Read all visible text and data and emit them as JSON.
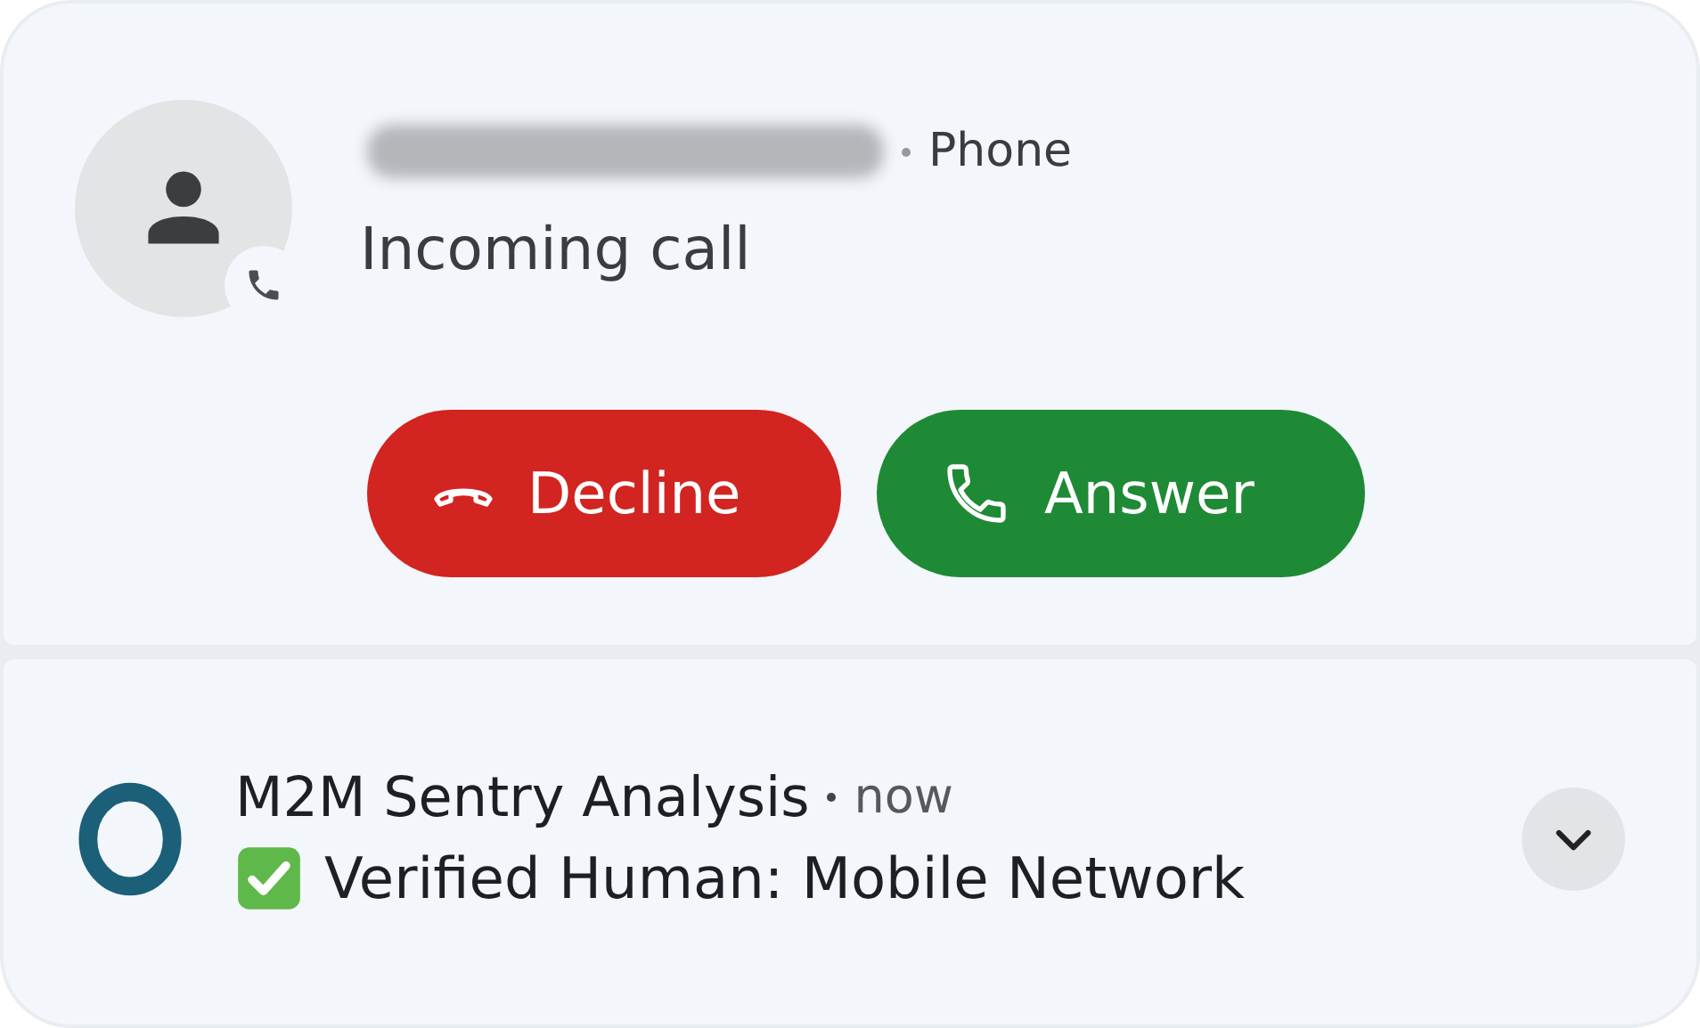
{
  "call": {
    "source": "Phone",
    "status": "Incoming call",
    "buttons": [
      {
        "kind": "decline",
        "label": "Decline"
      },
      {
        "kind": "answer",
        "label": "Answer"
      }
    ]
  },
  "notification": {
    "app": "M2M Sentry Analysis",
    "time": "now",
    "message": "Verified Human: Mobile Network",
    "expanded": false
  }
}
